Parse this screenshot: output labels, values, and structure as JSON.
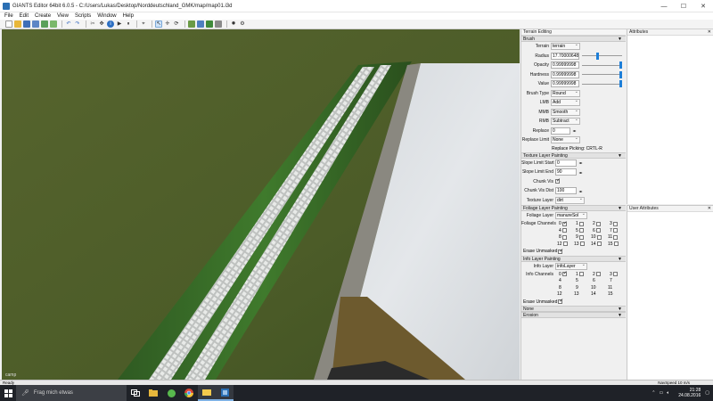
{
  "window": {
    "title": "GIANTS Editor 64bit 6.0.5 - C:/Users/Lukas/Desktop/Norddeutschland_GMK/map/map01.i3d"
  },
  "menu": [
    "File",
    "Edit",
    "Create",
    "View",
    "Scripts",
    "Window",
    "Help"
  ],
  "toolbar": {
    "icons": [
      "new-icon",
      "open-icon",
      "save-icon",
      "save-all-icon",
      "import-icon",
      "export-icon",
      "undo-icon",
      "redo-icon",
      "cut-icon",
      "move-icon",
      "info-icon",
      "play-icon",
      "pause-icon",
      "pick-icon",
      "select-icon",
      "translate-icon",
      "rotate-icon",
      "scale-icon",
      "terrain-icon",
      "paint-icon",
      "foliage-icon",
      "camera-icon",
      "light-icon",
      "settings-icon"
    ]
  },
  "viewport": {
    "status_text": "camp"
  },
  "terrain_panel": {
    "title": "Terrain Editing",
    "brush": {
      "header": "Brush",
      "terrain_label": "Terrain",
      "terrain_value": "terrain",
      "radius_label": "Radius",
      "radius_value": "17.70000648",
      "opacity_label": "Opacity",
      "opacity_value": "0.99999998",
      "hardness_label": "Hardness",
      "hardness_value": "0.99999998",
      "value_label": "Value",
      "value_value": "0.99999998",
      "brush_type_label": "Brush Type",
      "brush_type_value": "Round",
      "lmb_label": "LMB",
      "lmb_value": "Add",
      "mmb_label": "MMB",
      "mmb_value": "Smooth",
      "rmb_label": "RMB",
      "rmb_value": "Subtract",
      "replace_label": "Replace",
      "replace_value": "0",
      "replace_limit_label": "Replace Limit",
      "replace_limit_value": "None",
      "replace_picking": "Replace Picking: CRTL-R"
    },
    "texture": {
      "header": "Texture Layer Painting",
      "slope_start_label": "Slope Limit Start",
      "slope_start_value": "0",
      "slope_end_label": "Slope Limit End",
      "slope_end_value": "90",
      "chunk_vis_label": "Chunk Vis",
      "chunk_vis_dist_label": "Chunk Vis Dist",
      "chunk_vis_dist_value": "100",
      "texture_layer_label": "Texture Layer",
      "texture_layer_value": "dirt"
    },
    "foliage": {
      "header": "Foliage Layer Painting",
      "layer_label": "Foliage Layer",
      "layer_value": "manureSol",
      "channels_label": "Foliage Channels",
      "channels": [
        "0",
        "1",
        "2",
        "3",
        "4",
        "5",
        "6",
        "7",
        "8",
        "9",
        "10",
        "11",
        "12",
        "13",
        "14",
        "15"
      ],
      "erase_label": "Erase Unmasked"
    },
    "info": {
      "header": "Info Layer Painting",
      "layer_label": "Info Layer",
      "layer_value": "infoLayer",
      "channels_label": "Info Channels",
      "channels": [
        "0",
        "1",
        "2",
        "3",
        "4",
        "5",
        "6",
        "7",
        "8",
        "9",
        "10",
        "11",
        "12",
        "13",
        "14",
        "15"
      ],
      "erase_label": "Erase Unmasked"
    },
    "none_header": "None",
    "erosion_header": "Erosion"
  },
  "attributes_panel": {
    "title": "Attributes"
  },
  "user_attributes_panel": {
    "title": "User Attributes"
  },
  "statusbar": {
    "left": "Ready",
    "right": "NavSpeed 10 m/s"
  },
  "taskbar": {
    "search_placeholder": "Frag mich etwas",
    "time": "21:28",
    "date": "24.08.2016",
    "apps": [
      "task-view-icon",
      "file-explorer-icon",
      "xbox-icon",
      "chrome-icon",
      "folder-icon",
      "giants-editor-icon"
    ]
  },
  "colors": {
    "accent": "#1e7fd8",
    "taskbar": "#1f2228",
    "grass": "#4d5e2a"
  }
}
